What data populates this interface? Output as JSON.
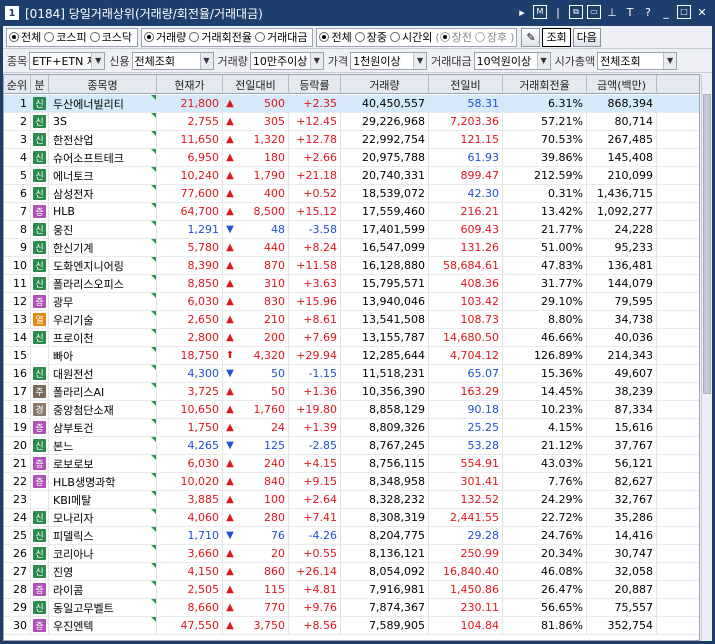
{
  "window": {
    "number": "1",
    "title": "[0184] 당일거래상위(거래량/회전율/거래대금)"
  },
  "options": {
    "market": [
      "전체",
      "코스피",
      "코스닥"
    ],
    "metric": [
      "거래량",
      "거래회전율",
      "거래대금"
    ],
    "session": [
      "전체",
      "장중",
      "시간외"
    ],
    "after": [
      "장전",
      "장후"
    ],
    "query_label": "조회",
    "next_label": "다음"
  },
  "filters": {
    "stock_label": "종목",
    "stock_value": "ETF+ETN 제",
    "credit_label": "신용",
    "credit_value": "전체조회",
    "volume_label": "거래량",
    "volume_value": "10만주이상",
    "price_label": "가격",
    "price_value": "1천원이상",
    "amount_label": "거래대금",
    "amount_value": "10억원이상",
    "cap_label": "시가총액",
    "cap_value": "전체조회"
  },
  "headers": [
    "순위",
    "분",
    "종목명",
    "현재가",
    "전일대비",
    "등락률",
    "거래량",
    "전일비",
    "거래회전율",
    "금액(백만)"
  ],
  "rows": [
    {
      "rank": "1",
      "tag": "신",
      "name": "두산에너빌리티",
      "price": "21,800",
      "dir": "up",
      "chg": "500",
      "rate": "+2.35",
      "vol": "40,450,557",
      "prev": "58.31",
      "turn": "6.31%",
      "amt": "868,394"
    },
    {
      "rank": "2",
      "tag": "신",
      "name": "3S",
      "price": "2,755",
      "dir": "up",
      "chg": "305",
      "rate": "+12.45",
      "vol": "29,226,968",
      "prev": "7,203.36",
      "turn": "57.21%",
      "amt": "80,714"
    },
    {
      "rank": "3",
      "tag": "신",
      "name": "한전산업",
      "price": "11,650",
      "dir": "up",
      "chg": "1,320",
      "rate": "+12.78",
      "vol": "22,992,754",
      "prev": "121.15",
      "turn": "70.53%",
      "amt": "267,485"
    },
    {
      "rank": "4",
      "tag": "신",
      "name": "슈어소프트테크",
      "price": "6,950",
      "dir": "up",
      "chg": "180",
      "rate": "+2.66",
      "vol": "20,975,788",
      "prev": "61.93",
      "turn": "39.86%",
      "amt": "145,408"
    },
    {
      "rank": "5",
      "tag": "신",
      "name": "에너토크",
      "price": "10,240",
      "dir": "up",
      "chg": "1,790",
      "rate": "+21.18",
      "vol": "20,740,331",
      "prev": "899.47",
      "turn": "212.59%",
      "amt": "210,099"
    },
    {
      "rank": "6",
      "tag": "신",
      "name": "삼성전자",
      "price": "77,600",
      "dir": "up",
      "chg": "400",
      "rate": "+0.52",
      "vol": "18,539,072",
      "prev": "42.30",
      "turn": "0.31%",
      "amt": "1,436,715"
    },
    {
      "rank": "7",
      "tag": "증",
      "name": "HLB",
      "price": "64,700",
      "dir": "up",
      "chg": "8,500",
      "rate": "+15.12",
      "vol": "17,559,460",
      "prev": "216.21",
      "turn": "13.42%",
      "amt": "1,092,277"
    },
    {
      "rank": "8",
      "tag": "신",
      "name": "웅진",
      "price": "1,291",
      "dir": "down",
      "chg": "48",
      "rate": "-3.58",
      "vol": "17,401,599",
      "prev": "609.43",
      "turn": "21.77%",
      "amt": "24,228"
    },
    {
      "rank": "9",
      "tag": "신",
      "name": "한신기계",
      "price": "5,780",
      "dir": "up",
      "chg": "440",
      "rate": "+8.24",
      "vol": "16,547,099",
      "prev": "131.26",
      "turn": "51.00%",
      "amt": "95,233"
    },
    {
      "rank": "10",
      "tag": "신",
      "name": "도화엔지니어링",
      "price": "8,390",
      "dir": "up",
      "chg": "870",
      "rate": "+11.58",
      "vol": "16,128,880",
      "prev": "58,684.61",
      "turn": "47.83%",
      "amt": "136,481"
    },
    {
      "rank": "11",
      "tag": "신",
      "name": "폴라리스오피스",
      "price": "8,850",
      "dir": "up",
      "chg": "310",
      "rate": "+3.63",
      "vol": "15,795,571",
      "prev": "408.36",
      "turn": "31.77%",
      "amt": "144,079"
    },
    {
      "rank": "12",
      "tag": "증",
      "name": "광무",
      "price": "6,030",
      "dir": "up",
      "chg": "830",
      "rate": "+15.96",
      "vol": "13,940,046",
      "prev": "103.42",
      "turn": "29.10%",
      "amt": "79,595"
    },
    {
      "rank": "13",
      "tag": "열",
      "name": "우리기술",
      "price": "2,650",
      "dir": "up",
      "chg": "210",
      "rate": "+8.61",
      "vol": "13,541,508",
      "prev": "108.73",
      "turn": "8.80%",
      "amt": "34,738"
    },
    {
      "rank": "14",
      "tag": "신",
      "name": "프로이천",
      "price": "2,800",
      "dir": "up",
      "chg": "200",
      "rate": "+7.69",
      "vol": "13,155,787",
      "prev": "14,680.50",
      "turn": "46.66%",
      "amt": "40,036"
    },
    {
      "rank": "15",
      "tag": "",
      "name": "빠아",
      "price": "18,750",
      "dir": "uplimit",
      "chg": "4,320",
      "rate": "+29.94",
      "vol": "12,285,644",
      "prev": "4,704.12",
      "turn": "126.89%",
      "amt": "214,343"
    },
    {
      "rank": "16",
      "tag": "신",
      "name": "대원전선",
      "price": "4,300",
      "dir": "down",
      "chg": "50",
      "rate": "-1.15",
      "vol": "11,518,231",
      "prev": "65.07",
      "turn": "15.36%",
      "amt": "49,607"
    },
    {
      "rank": "17",
      "tag": "주",
      "name": "폴라리스AI",
      "price": "3,725",
      "dir": "up",
      "chg": "50",
      "rate": "+1.36",
      "vol": "10,356,390",
      "prev": "163.29",
      "turn": "14.45%",
      "amt": "38,239"
    },
    {
      "rank": "18",
      "tag": "경",
      "name": "중앙첨단소재",
      "price": "10,650",
      "dir": "up",
      "chg": "1,760",
      "rate": "+19.80",
      "vol": "8,858,129",
      "prev": "90.18",
      "turn": "10.23%",
      "amt": "87,334"
    },
    {
      "rank": "19",
      "tag": "증",
      "name": "삼부토건",
      "price": "1,750",
      "dir": "up",
      "chg": "24",
      "rate": "+1.39",
      "vol": "8,809,326",
      "prev": "25.25",
      "turn": "4.15%",
      "amt": "15,616"
    },
    {
      "rank": "20",
      "tag": "신",
      "name": "본느",
      "price": "4,265",
      "dir": "down",
      "chg": "125",
      "rate": "-2.85",
      "vol": "8,767,245",
      "prev": "53.28",
      "turn": "21.12%",
      "amt": "37,767"
    },
    {
      "rank": "21",
      "tag": "증",
      "name": "로보로보",
      "price": "6,030",
      "dir": "up",
      "chg": "240",
      "rate": "+4.15",
      "vol": "8,756,115",
      "prev": "554.91",
      "turn": "43.03%",
      "amt": "56,121"
    },
    {
      "rank": "22",
      "tag": "증",
      "name": "HLB생명과학",
      "price": "10,020",
      "dir": "up",
      "chg": "840",
      "rate": "+9.15",
      "vol": "8,348,958",
      "prev": "301.41",
      "turn": "7.76%",
      "amt": "82,627"
    },
    {
      "rank": "23",
      "tag": "",
      "name": "KBI메탈",
      "price": "3,885",
      "dir": "up",
      "chg": "100",
      "rate": "+2.64",
      "vol": "8,328,232",
      "prev": "132.52",
      "turn": "24.29%",
      "amt": "32,767"
    },
    {
      "rank": "24",
      "tag": "신",
      "name": "모나리자",
      "price": "4,060",
      "dir": "up",
      "chg": "280",
      "rate": "+7.41",
      "vol": "8,308,319",
      "prev": "2,441.55",
      "turn": "22.72%",
      "amt": "35,286"
    },
    {
      "rank": "25",
      "tag": "신",
      "name": "피델릭스",
      "price": "1,710",
      "dir": "down",
      "chg": "76",
      "rate": "-4.26",
      "vol": "8,204,775",
      "prev": "29.28",
      "turn": "24.76%",
      "amt": "14,416"
    },
    {
      "rank": "26",
      "tag": "신",
      "name": "코리아나",
      "price": "3,660",
      "dir": "up",
      "chg": "20",
      "rate": "+0.55",
      "vol": "8,136,121",
      "prev": "250.99",
      "turn": "20.34%",
      "amt": "30,747"
    },
    {
      "rank": "27",
      "tag": "신",
      "name": "진영",
      "price": "4,150",
      "dir": "up",
      "chg": "860",
      "rate": "+26.14",
      "vol": "8,054,092",
      "prev": "16,840.40",
      "turn": "46.08%",
      "amt": "32,058"
    },
    {
      "rank": "28",
      "tag": "증",
      "name": "라이콤",
      "price": "2,505",
      "dir": "up",
      "chg": "115",
      "rate": "+4.81",
      "vol": "7,916,981",
      "prev": "1,450.86",
      "turn": "26.47%",
      "amt": "20,887"
    },
    {
      "rank": "29",
      "tag": "신",
      "name": "동일고무벨트",
      "price": "8,660",
      "dir": "up",
      "chg": "770",
      "rate": "+9.76",
      "vol": "7,874,367",
      "prev": "230.11",
      "turn": "56.65%",
      "amt": "75,557"
    },
    {
      "rank": "30",
      "tag": "증",
      "name": "우진엔텍",
      "price": "47,550",
      "dir": "up",
      "chg": "3,750",
      "rate": "+8.56",
      "vol": "7,589,905",
      "prev": "104.84",
      "turn": "81.86%",
      "amt": "352,754"
    }
  ],
  "tag_colors": {
    "신": "#2d8a4e",
    "증": "#b050b8",
    "열": "#e08a12",
    "주": "#7a6a5a",
    "경": "#8c7a6c",
    "": "transparent"
  },
  "colors": {
    "up": "#e0161b",
    "down": "#1f4fd6",
    "title_bg": "#1d3f6e"
  }
}
